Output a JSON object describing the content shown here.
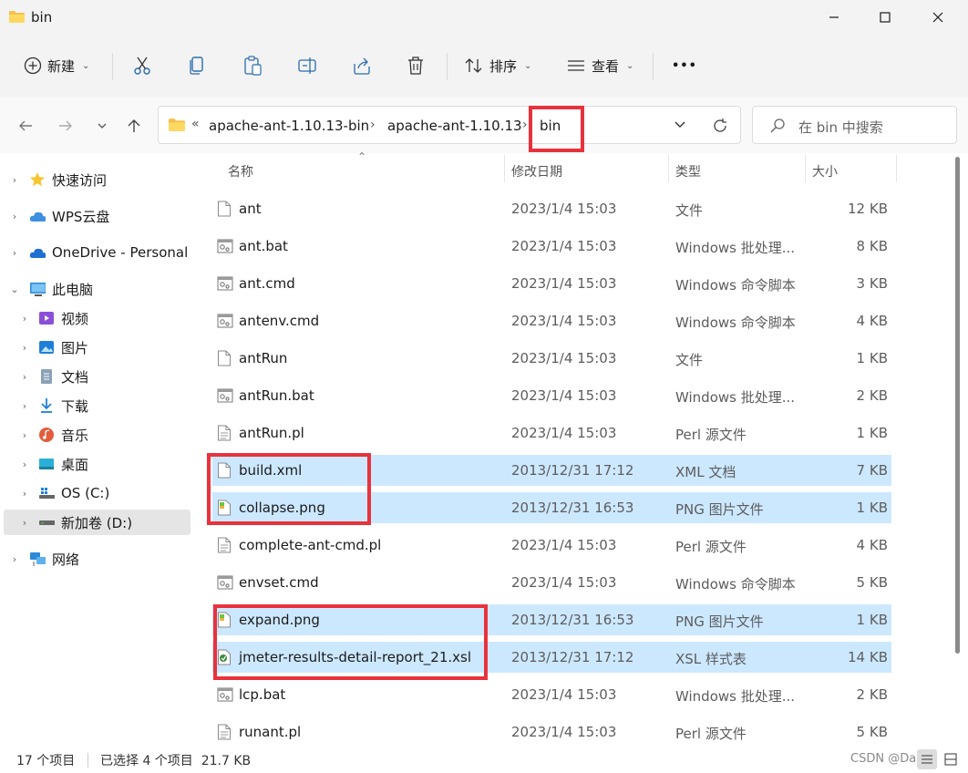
{
  "window": {
    "title": "bin",
    "minimize_label": "—",
    "maximize_label": "☐",
    "close_label": "✕"
  },
  "toolbar": {
    "new_label": "新建",
    "sort_label": "排序",
    "view_label": "查看",
    "more_label": "•••"
  },
  "breadcrumb": {
    "overflow": "«",
    "items": [
      "apache-ant-1.10.13-bin",
      "apache-ant-1.10.13",
      "bin"
    ],
    "separator": "›"
  },
  "search": {
    "placeholder": "在 bin 中搜索"
  },
  "sidebar": {
    "items": [
      {
        "label": "快速访问",
        "icon": "star-icon"
      },
      {
        "label": "WPS云盘",
        "icon": "cloud-icon"
      },
      {
        "label": "OneDrive - Personal",
        "icon": "onedrive-icon"
      },
      {
        "label": "此电脑",
        "icon": "computer-icon"
      },
      {
        "label": "视频",
        "icon": "video-icon"
      },
      {
        "label": "图片",
        "icon": "picture-icon"
      },
      {
        "label": "文档",
        "icon": "document-icon"
      },
      {
        "label": "下载",
        "icon": "download-icon"
      },
      {
        "label": "音乐",
        "icon": "music-icon"
      },
      {
        "label": "桌面",
        "icon": "desktop-icon"
      },
      {
        "label": "OS (C:)",
        "icon": "drive-icon"
      },
      {
        "label": "新加卷 (D:)",
        "icon": "drive-icon"
      },
      {
        "label": "网络",
        "icon": "network-icon"
      }
    ]
  },
  "columns": {
    "name": "名称",
    "date": "修改日期",
    "type": "类型",
    "size": "大小"
  },
  "files": [
    {
      "name": "ant",
      "date": "2023/1/4 15:03",
      "type": "文件",
      "size": "12 KB",
      "selected": false,
      "icon": "file-icon"
    },
    {
      "name": "ant.bat",
      "date": "2023/1/4 15:03",
      "type": "Windows 批处理...",
      "size": "8 KB",
      "selected": false,
      "icon": "batch-file-icon"
    },
    {
      "name": "ant.cmd",
      "date": "2023/1/4 15:03",
      "type": "Windows 命令脚本",
      "size": "3 KB",
      "selected": false,
      "icon": "batch-file-icon"
    },
    {
      "name": "antenv.cmd",
      "date": "2023/1/4 15:03",
      "type": "Windows 命令脚本",
      "size": "4 KB",
      "selected": false,
      "icon": "batch-file-icon"
    },
    {
      "name": "antRun",
      "date": "2023/1/4 15:03",
      "type": "文件",
      "size": "1 KB",
      "selected": false,
      "icon": "file-icon"
    },
    {
      "name": "antRun.bat",
      "date": "2023/1/4 15:03",
      "type": "Windows 批处理...",
      "size": "2 KB",
      "selected": false,
      "icon": "batch-file-icon"
    },
    {
      "name": "antRun.pl",
      "date": "2023/1/4 15:03",
      "type": "Perl 源文件",
      "size": "1 KB",
      "selected": false,
      "icon": "text-file-icon"
    },
    {
      "name": "build.xml",
      "date": "2013/12/31 17:12",
      "type": "XML 文档",
      "size": "7 KB",
      "selected": true,
      "icon": "file-icon"
    },
    {
      "name": "collapse.png",
      "date": "2013/12/31 16:53",
      "type": "PNG 图片文件",
      "size": "1 KB",
      "selected": true,
      "icon": "image-file-icon"
    },
    {
      "name": "complete-ant-cmd.pl",
      "date": "2023/1/4 15:03",
      "type": "Perl 源文件",
      "size": "4 KB",
      "selected": false,
      "icon": "text-file-icon"
    },
    {
      "name": "envset.cmd",
      "date": "2023/1/4 15:03",
      "type": "Windows 命令脚本",
      "size": "5 KB",
      "selected": false,
      "icon": "batch-file-icon"
    },
    {
      "name": "expand.png",
      "date": "2013/12/31 16:53",
      "type": "PNG 图片文件",
      "size": "1 KB",
      "selected": true,
      "icon": "image-file-icon"
    },
    {
      "name": "jmeter-results-detail-report_21.xsl",
      "date": "2013/12/31 17:12",
      "type": "XSL 样式表",
      "size": "14 KB",
      "selected": true,
      "icon": "xsl-file-icon"
    },
    {
      "name": "lcp.bat",
      "date": "2023/1/4 15:03",
      "type": "Windows 批处理...",
      "size": "2 KB",
      "selected": false,
      "icon": "batch-file-icon"
    },
    {
      "name": "runant.pl",
      "date": "2023/1/4 15:03",
      "type": "Perl 源文件",
      "size": "5 KB",
      "selected": false,
      "icon": "text-file-icon"
    }
  ],
  "status": {
    "item_count": "17 个项目",
    "selection": "已选择 4 个项目  21.7 KB",
    "watermark": "CSDN @Daron"
  },
  "colors": {
    "selection": "#cce8ff",
    "highlight_box": "#e8323c",
    "folder": "#f5c14b"
  }
}
